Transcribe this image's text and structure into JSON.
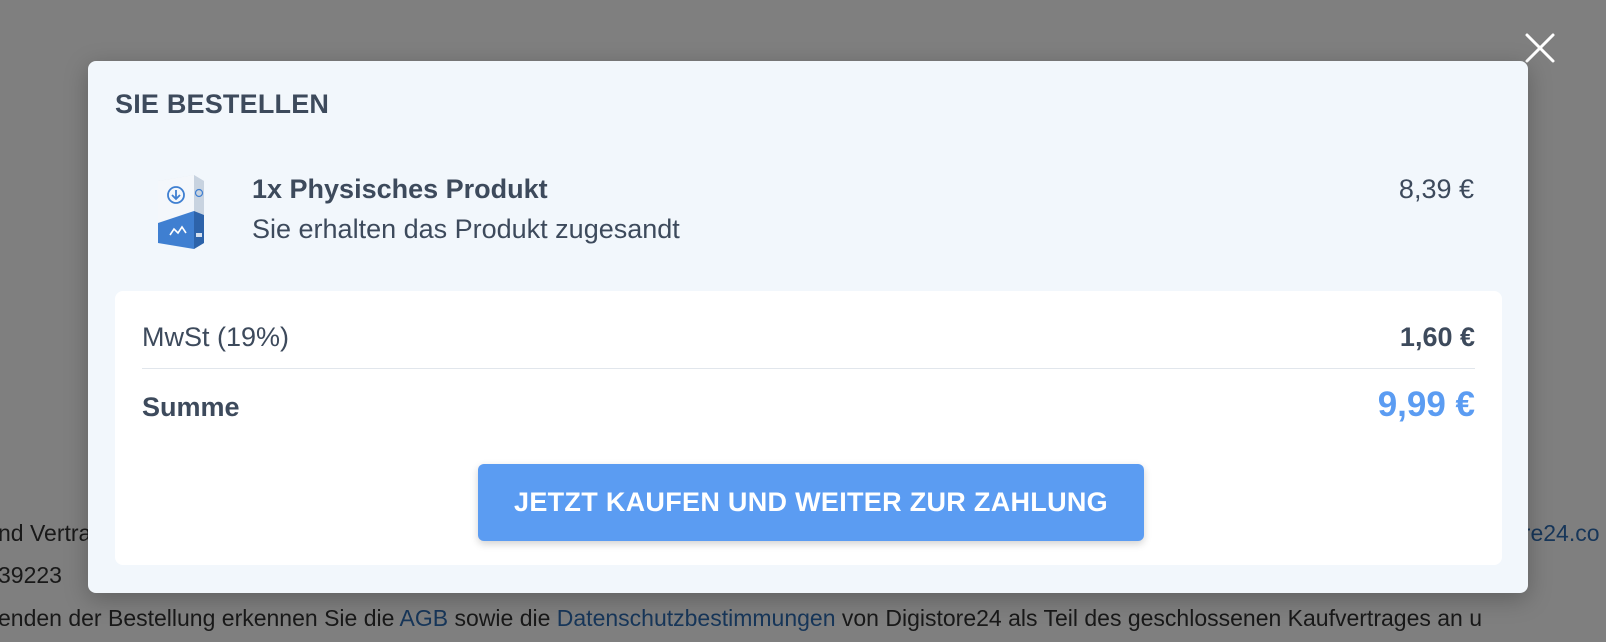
{
  "background": {
    "line1_left": "nd Vertra",
    "line1_right": "ore24.co",
    "line2_left": "39223",
    "line3_prefix": "enden der Bestellung erkennen Sie die ",
    "line3_link_agb": "AGB",
    "line3_middle": " sowie die ",
    "line3_link_privacy": "Datenschutzbestimmungen",
    "line3_suffix": " von Digistore24 als Teil des geschlossenen Kaufvertrages an u"
  },
  "modal": {
    "title": "SIE BESTELLEN",
    "close_icon": "close-icon",
    "product": {
      "icon": "product-box-icon",
      "name": "1x Physisches Produkt",
      "description": "Sie erhalten das Produkt zugesandt",
      "price": "8,39 €"
    },
    "summary": {
      "tax_label": "MwSt (19%)",
      "tax_value": "1,60 €",
      "total_label": "Summe",
      "total_value": "9,99 €"
    },
    "buy_button_label": "JETZT KAUFEN UND WEITER ZUR ZAHLUNG"
  },
  "colors": {
    "accent": "#5b9cf2",
    "text": "#3d4a5c",
    "modal_bg": "#f2f7fc",
    "link": "#2f6db3"
  }
}
